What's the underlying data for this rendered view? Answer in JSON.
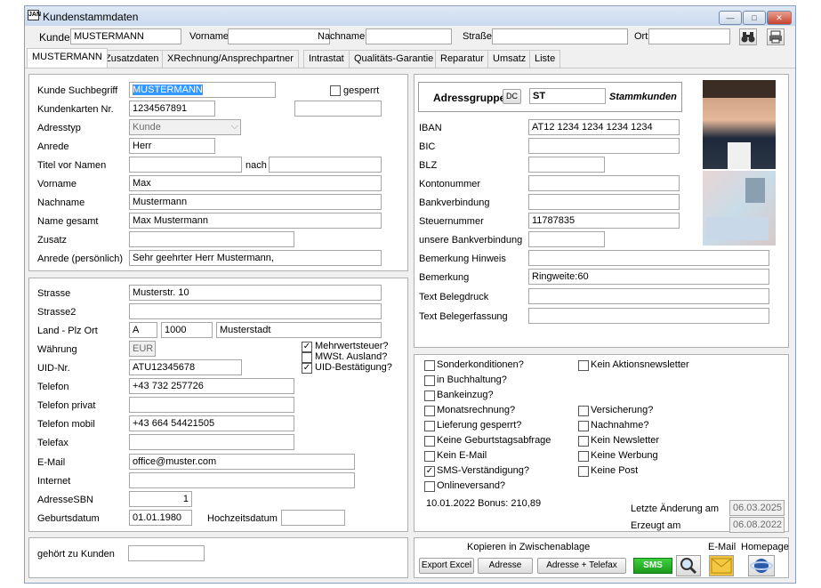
{
  "window": {
    "title": "Kundenstammdaten",
    "logo": "JAN",
    "minimize": "—",
    "maximize": "□",
    "close": "✕"
  },
  "search": {
    "kunde_label": "Kunde",
    "kunde_value": "MUSTERMANN",
    "vorname_label": "Vorname",
    "vorname_value": "",
    "nachname_label": "Nachname",
    "nachname_value": "",
    "strasse_label": "Straße",
    "strasse_value": "",
    "ort_label": "Ort",
    "ort_value": "",
    "binoculars_icon": "binoculars-icon",
    "print_icon": "print-icon"
  },
  "tabs": [
    "MUSTERMANN",
    "Zusatzdaten",
    "XRechnung/Ansprechpartner",
    "Intrastat",
    "Qualitäts-Garantie",
    "Reparatur",
    "Umsatz",
    "Liste"
  ],
  "customer": {
    "suchbegriff_label": "Kunde Suchbegriff",
    "suchbegriff_value": "MUSTERMANN",
    "gesperrt_label": "gesperrt",
    "kundenkarten_label": "Kundenkarten Nr.",
    "kundenkarten_value": "1234567891",
    "kundenkarten_extra": "",
    "adresstyp_label": "Adresstyp",
    "adresstyp_value": "Kunde",
    "anrede_label": "Anrede",
    "anrede_value": "Herr",
    "titel_label": "Titel vor Namen",
    "titel_value": "",
    "nach_label": "nach",
    "nach_value": "",
    "vorname_label": "Vorname",
    "vorname_value": "Max",
    "nachname_label": "Nachname",
    "nachname_value": "Mustermann",
    "name_gesamt_label": "Name gesamt",
    "name_gesamt_value": "Max Mustermann",
    "zusatz_label": "Zusatz",
    "zusatz_value": "",
    "anrede_pers_label": "Anrede (persönlich)",
    "anrede_pers_value": "Sehr geehrter Herr Mustermann,"
  },
  "address": {
    "strasse_label": "Strasse",
    "strasse_value": "Musterstr. 10",
    "strasse2_label": "Strasse2",
    "strasse2_value": "",
    "land_label": "Land - Plz  Ort",
    "land_value": "A",
    "plz_value": "1000",
    "ort_value": "Musterstadt",
    "waehrung_label": "Währung",
    "waehrung_value": "EUR",
    "mwst_label": "Mehrwertsteuer?",
    "mwst_ausland_label": "MWSt. Ausland?",
    "uid_best_label": "UID-Bestätigung?",
    "uid_label": "UID-Nr.",
    "uid_value": "ATU12345678",
    "telefon_label": "Telefon",
    "telefon_value": "+43 732 257726",
    "telefon_privat_label": "Telefon privat",
    "telefon_privat_value": "",
    "telefon_mobil_label": "Telefon mobil",
    "telefon_mobil_value": "+43 664 54421505",
    "telefax_label": "Telefax",
    "telefax_value": "",
    "email_label": "E-Mail",
    "email_value": "office@muster.com",
    "internet_label": "Internet",
    "internet_value": "",
    "adresse_sbn_label": "AdresseSBN",
    "adresse_sbn_value": "1",
    "geburtsdatum_label": "Geburtsdatum",
    "geburtsdatum_value": "01.01.1980",
    "hochzeitsdatum_label": "Hochzeitsdatum",
    "hochzeitsdatum_value": ""
  },
  "gehoert": {
    "label": "gehört zu Kunden",
    "value": ""
  },
  "bank": {
    "adressgruppe_label": "Adressgruppe",
    "dc_label": "DC",
    "gruppe_code": "ST",
    "gruppe_name": "Stammkunden",
    "iban_label": "IBAN",
    "iban_value": "AT12 1234 1234 1234 1234",
    "bic_label": "BIC",
    "bic_value": "",
    "blz_label": "BLZ",
    "blz_value": "",
    "konto_label": "Kontonummer",
    "konto_value": "",
    "bankverb_label": "Bankverbindung",
    "bankverb_value": "",
    "steuer_label": "Steuernummer",
    "steuer_value": "11787835",
    "unsere_bank_label": "unsere Bankverbindung",
    "unsere_bank_value": "",
    "bem_hinweis_label": "Bemerkung Hinweis",
    "bem_hinweis_value": "",
    "bemerkung_label": "Bemerkung",
    "bemerkung_value": "Ringweite:60",
    "text_belegdruck_label": "Text Belegdruck",
    "text_belegdruck_value": "",
    "text_belegerf_label": "Text Belegerfassung",
    "text_belegerf_value": ""
  },
  "options": {
    "sonderkonditionen": "Sonderkonditionen?",
    "kein_aktion": "Kein Aktionsnewsletter",
    "in_buchhaltung": "in Buchhaltung?",
    "bankeinzug": "Bankeinzug?",
    "monatsrechnung": "Monatsrechnung?",
    "versicherung": "Versicherung?",
    "lieferung_gesperrt": "Lieferung gesperrt?",
    "nachnahme": "Nachnahme?",
    "keine_geburtstag": "Keine Geburtstagsabfrage",
    "kein_newsletter": "Kein Newsletter",
    "kein_email": "Kein E-Mail",
    "keine_werbung": "Keine Werbung",
    "sms": "SMS-Verständigung?",
    "keine_post": "Keine Post",
    "onlineversand": "Onlineversand?",
    "bonus_text": "10.01.2022 Bonus: 210,89",
    "letzte_label": "Letzte Änderung am",
    "letzte_value": "06.03.2025",
    "erzeugt_label": "Erzeugt am",
    "erzeugt_value": "06.08.2022"
  },
  "actions": {
    "kopieren_label": "Kopieren in Zwischenablage",
    "export_excel": "Export Excel",
    "adresse": "Adresse",
    "adresse_telefax": "Adresse + Telefax",
    "sms": "SMS",
    "email_label": "E-Mail",
    "homepage_label": "Homepage"
  },
  "colors": {
    "accent": "#3399ff",
    "sms_green": "#22b022"
  }
}
